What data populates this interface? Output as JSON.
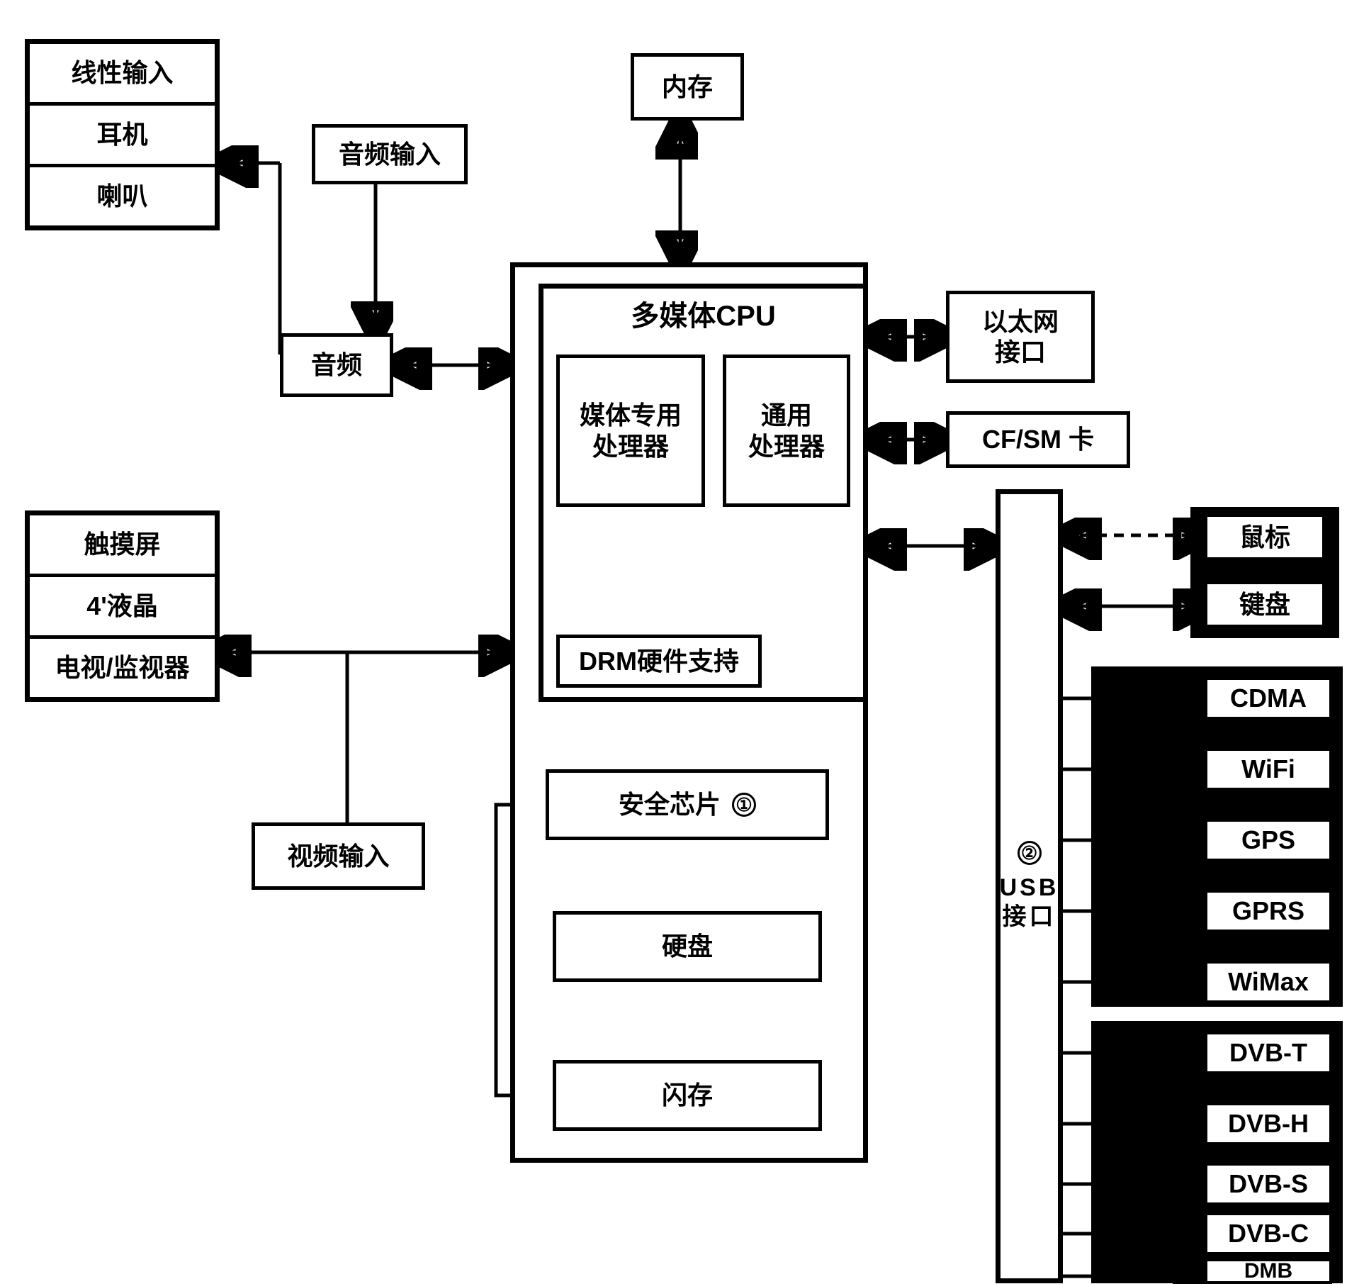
{
  "audio_outputs": {
    "line_in": "线性输入",
    "headphone": "耳机",
    "speaker": "喇叭"
  },
  "audio_input": "音频输入",
  "audio": "音频",
  "memory": "内存",
  "cpu": {
    "title": "多媒体CPU",
    "media_proc": "媒体专用\n处理器",
    "general_proc": "通用\n处理器",
    "drm": "DRM硬件支持"
  },
  "security_chip": "安全芯片",
  "hdd": "硬盘",
  "flash": "闪存",
  "video_input": "视频输入",
  "display": {
    "touch": "触摸屏",
    "lcd": "4'液晶",
    "tv": "电视/监视器"
  },
  "ethernet": "以太网\n接口",
  "cf_sm": "CF/SM 卡",
  "usb": "USB接口",
  "mouse": "鼠标",
  "keyboard": "键盘",
  "peripherals": [
    "CDMA",
    "WiFi",
    "GPS",
    "GPRS",
    "WiMax",
    "DVB-T",
    "DVB-H",
    "DVB-S",
    "DVB-C",
    "DMB"
  ],
  "marker1": "①",
  "marker2": "②"
}
